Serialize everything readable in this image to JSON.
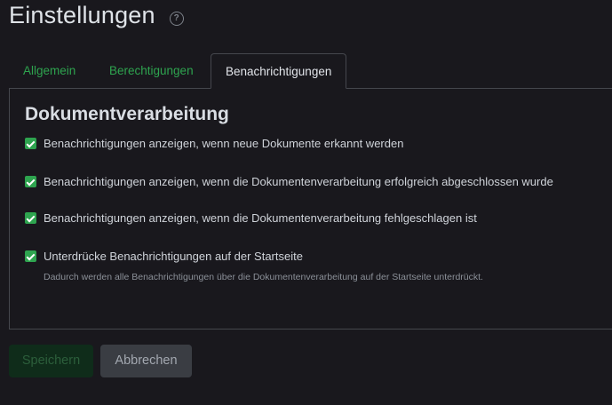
{
  "header": {
    "title": "Einstellungen",
    "help_icon_glyph": "?"
  },
  "tabs": [
    {
      "label": "Allgemein",
      "active": false
    },
    {
      "label": "Berechtigungen",
      "active": false
    },
    {
      "label": "Benachrichtigungen",
      "active": true
    }
  ],
  "section": {
    "title": "Dokumentverarbeitung",
    "options": [
      {
        "label": "Benachrichtigungen anzeigen, wenn neue Dokumente erkannt werden",
        "checked": true
      },
      {
        "label": "Benachrichtigungen anzeigen, wenn die Dokumentenverarbeitung erfolgreich abgeschlossen wurde",
        "checked": true
      },
      {
        "label": "Benachrichtigungen anzeigen, wenn die Dokumentenverarbeitung fehlgeschlagen ist",
        "checked": true
      },
      {
        "label": "Unterdrücke Benachrichtigungen auf der Startseite",
        "checked": true,
        "help": "Dadurch werden alle Benachrichtigungen über die Dokumentenverarbeitung auf der Startseite unterdrückt."
      }
    ]
  },
  "actions": {
    "save_label": "Speichern",
    "cancel_label": "Abbrechen"
  },
  "colors": {
    "accent": "#2ea44f",
    "background": "#19181d",
    "border": "#45474d"
  }
}
